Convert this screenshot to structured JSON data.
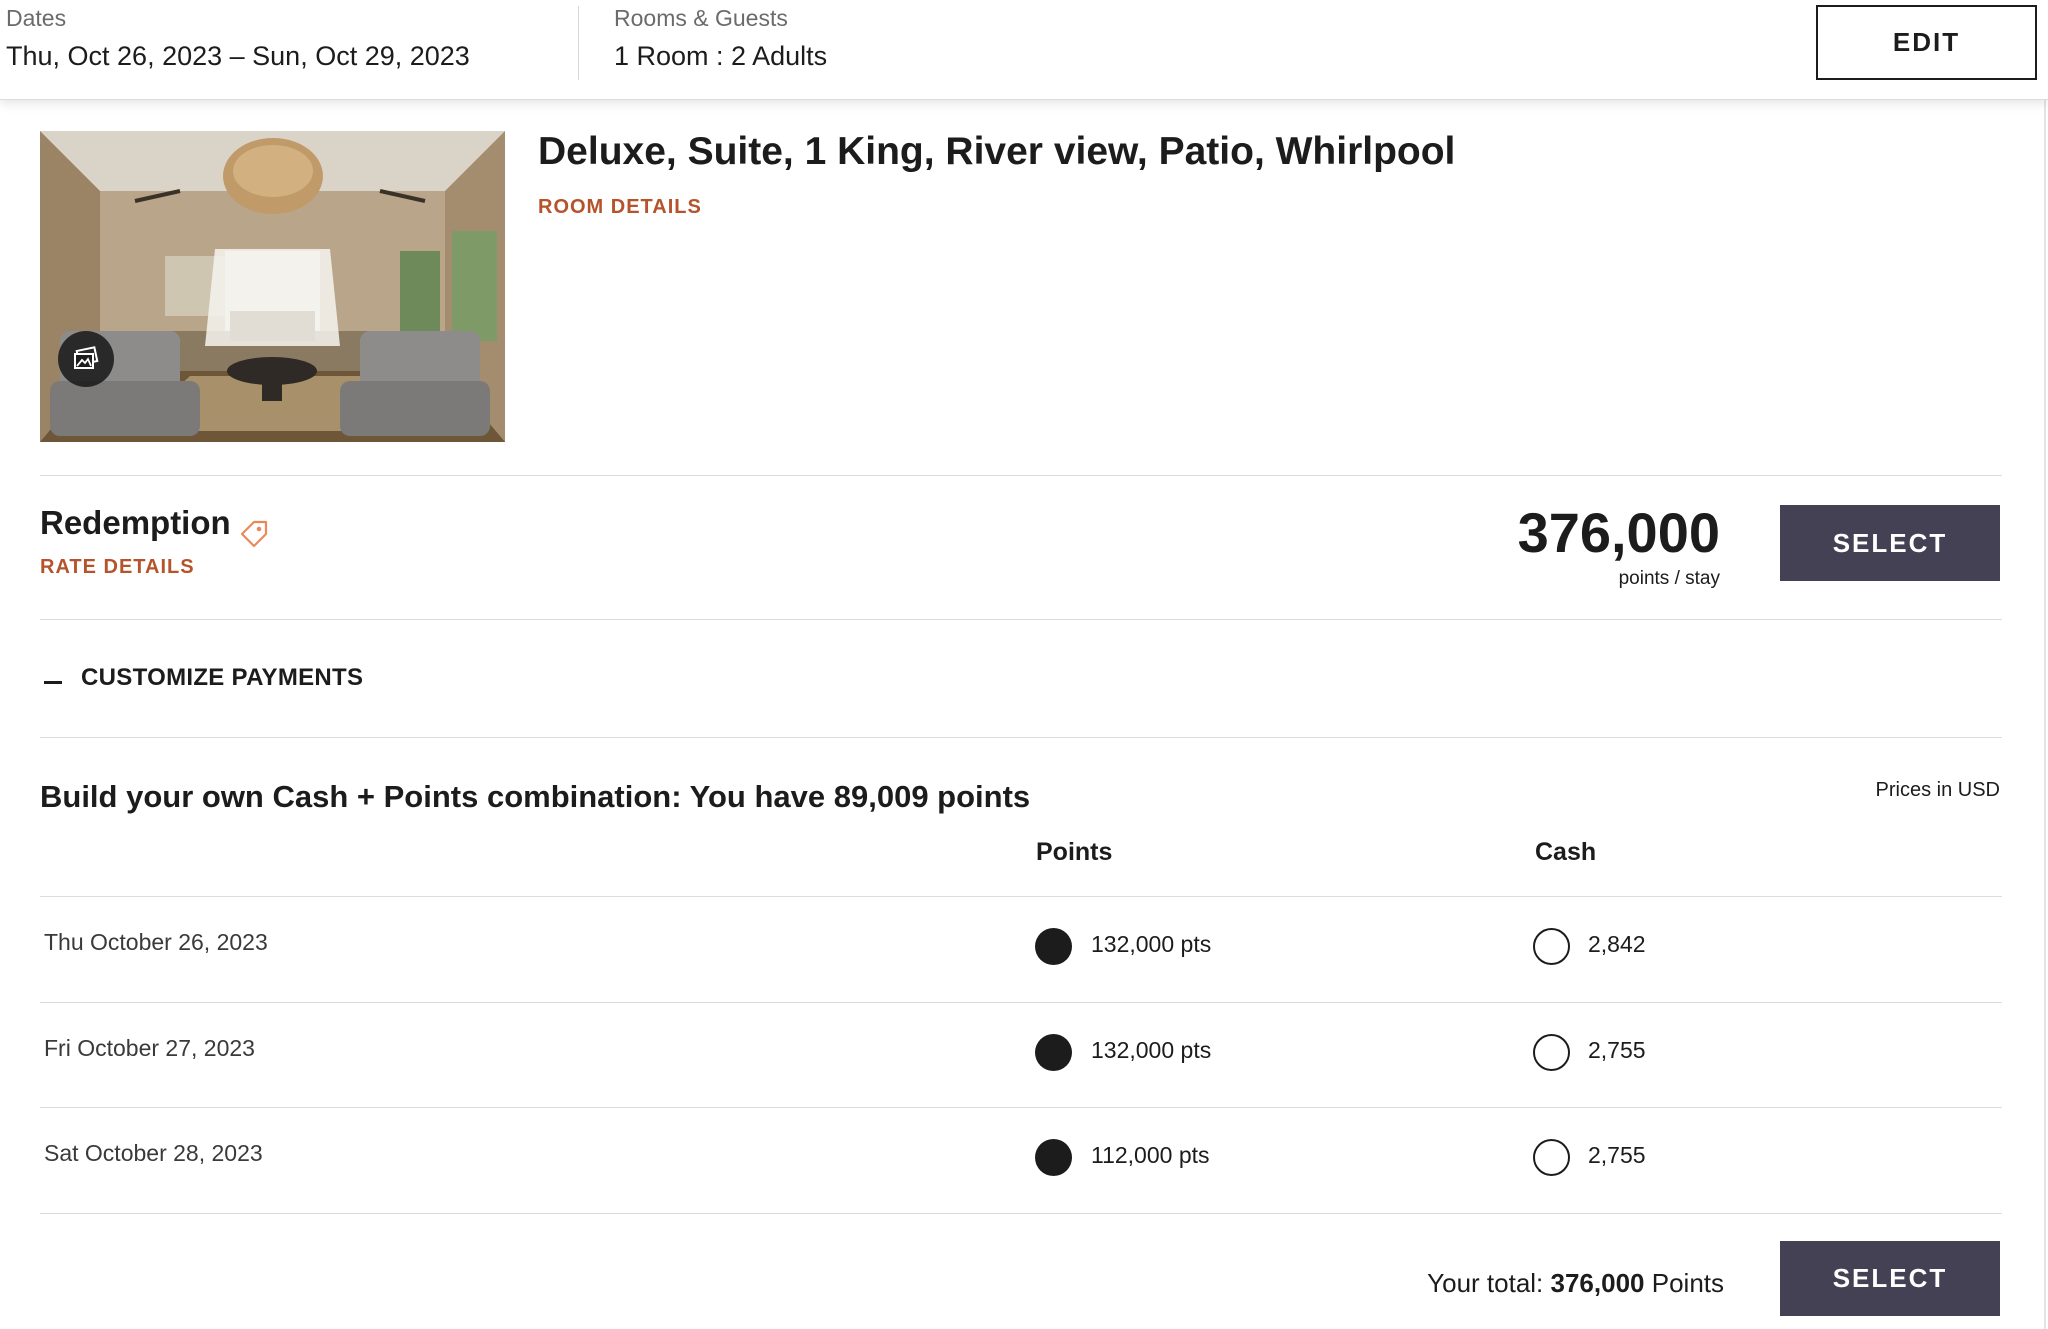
{
  "search_bar": {
    "dates_label": "Dates",
    "dates_value": "Thu, Oct 26, 2023 – Sun, Oct 29, 2023",
    "rooms_label": "Rooms & Guests",
    "rooms_value": "1 Room : 2 Adults",
    "edit_label": "EDIT"
  },
  "room": {
    "title": "Deluxe, Suite, 1 King, River view, Patio, Whirlpool",
    "details_link": "ROOM DETAILS",
    "photo_icon": "gallery-icon"
  },
  "rate": {
    "name": "Redemption",
    "tag_icon": "tag-icon",
    "details_link": "RATE DETAILS",
    "points": "376,000",
    "unit": "points / stay",
    "select_label": "SELECT"
  },
  "customize": {
    "toggle_icon": "minus-icon",
    "label": "CUSTOMIZE PAYMENTS"
  },
  "builder": {
    "heading": "Build your own Cash + Points combination: You have 89,009 points",
    "prices_note": "Prices in USD",
    "col_points": "Points",
    "col_cash": "Cash",
    "nights": [
      {
        "date": "Thu October 26, 2023",
        "points": "132,000 pts",
        "cash": "2,842",
        "selected": "points"
      },
      {
        "date": "Fri October 27, 2023",
        "points": "132,000 pts",
        "cash": "2,755",
        "selected": "points"
      },
      {
        "date": "Sat October 28, 2023",
        "points": "112,000 pts",
        "cash": "2,755",
        "selected": "points"
      }
    ],
    "total_prefix": "Your total:",
    "total_value": "376,000",
    "total_suffix": "Points",
    "select_label": "SELECT"
  },
  "colors": {
    "accent_link": "#b5532a",
    "button_bg": "#434153",
    "tag_icon": "#e9895a"
  }
}
